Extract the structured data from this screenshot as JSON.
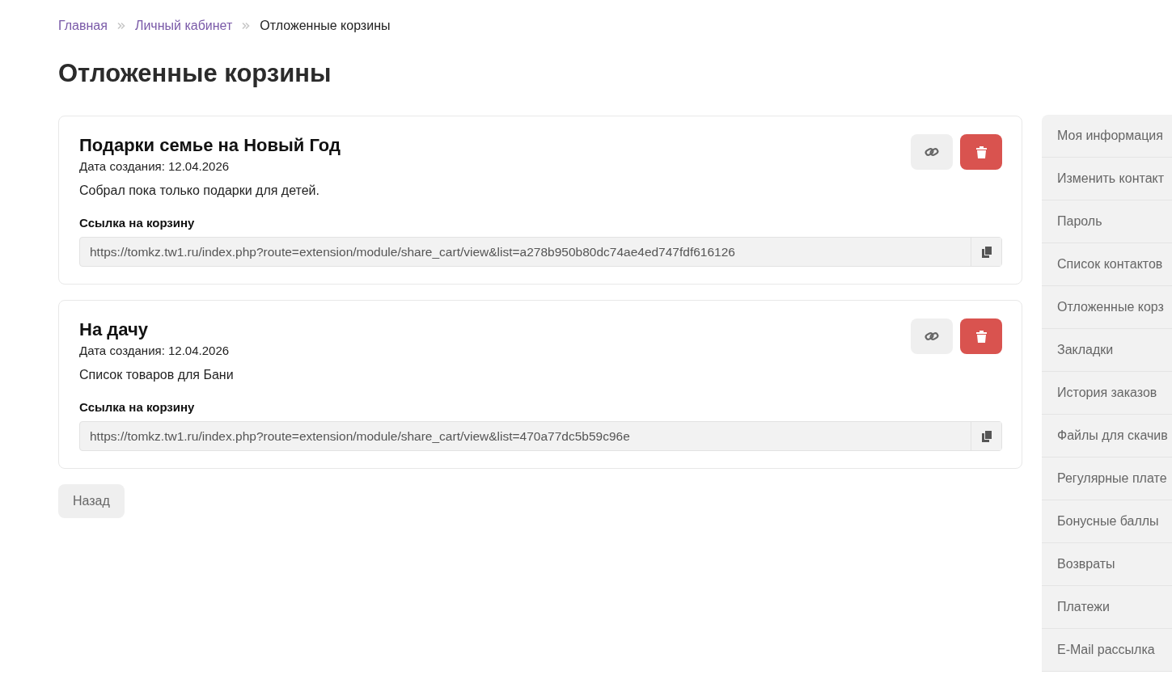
{
  "breadcrumbs": [
    {
      "label": "Главная",
      "kind": "link"
    },
    {
      "label": "Личный кабинет",
      "kind": "link"
    },
    {
      "label": "Отложенные корзины",
      "kind": "current"
    }
  ],
  "heading": "Отложенные корзины",
  "carts": [
    {
      "title": "Подарки семье на Новый Год",
      "date": "Дата создания: 12.04.2026",
      "comment": "Собрал пока только подарки для детей.",
      "link_label": "Ссылка на корзину",
      "link": "https://tomkz.tw1.ru/index.php?route=extension/module/share_cart/view&list=a278b950b80dc74ae4ed747fdf616126"
    },
    {
      "title": "На дачу",
      "date": "Дата создания: 12.04.2026",
      "comment": "Список товаров для Бани",
      "link_label": "Ссылка на корзину",
      "link": "https://tomkz.tw1.ru/index.php?route=extension/module/share_cart/view&list=470a77dc5b59c96e"
    }
  ],
  "back_button": "Назад",
  "sidebar": {
    "items": [
      "Моя информация",
      "Изменить контакт",
      "Пароль",
      "Список контактов",
      "Отложенные корз",
      "Закладки",
      "История заказов",
      "Файлы для скачив",
      "Регулярные плате",
      "Бонусные баллы",
      "Возвраты",
      "Платежи",
      "E-Mail рассылка"
    ]
  }
}
